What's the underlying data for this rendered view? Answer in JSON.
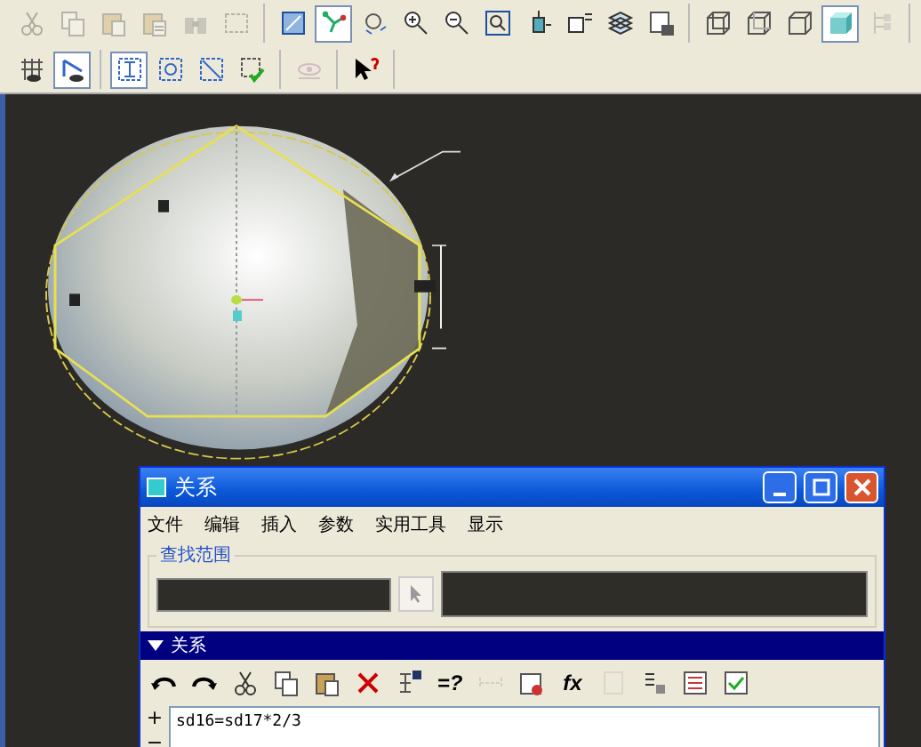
{
  "toolbar_rows": [
    {
      "groups": [
        [
          {
            "kind": "cut",
            "pressed": false,
            "disabled": true
          },
          {
            "kind": "copy",
            "pressed": false,
            "disabled": true
          },
          {
            "kind": "paste",
            "pressed": false,
            "disabled": true
          },
          {
            "kind": "paste-special",
            "pressed": false,
            "disabled": true
          },
          {
            "kind": "find",
            "pressed": false,
            "disabled": true
          },
          {
            "kind": "select-box",
            "pressed": false,
            "disabled": true
          }
        ],
        [
          {
            "kind": "sketch",
            "pressed": false,
            "disabled": false
          },
          {
            "kind": "datum",
            "pressed": true,
            "disabled": false
          },
          {
            "kind": "spin",
            "pressed": false,
            "disabled": false
          },
          {
            "kind": "zoom-in",
            "pressed": false,
            "disabled": false
          },
          {
            "kind": "zoom-out",
            "pressed": false,
            "disabled": false
          },
          {
            "kind": "refit",
            "pressed": false,
            "disabled": false
          },
          {
            "kind": "orient",
            "pressed": false,
            "disabled": false
          },
          {
            "kind": "view",
            "pressed": false,
            "disabled": false
          },
          {
            "kind": "layers",
            "pressed": false,
            "disabled": false
          },
          {
            "kind": "setup",
            "pressed": false,
            "disabled": false
          }
        ],
        [
          {
            "kind": "wireframe",
            "pressed": false,
            "disabled": false
          },
          {
            "kind": "hidden",
            "pressed": false,
            "disabled": false
          },
          {
            "kind": "no-hidden",
            "pressed": false,
            "disabled": false
          },
          {
            "kind": "shaded",
            "pressed": true,
            "disabled": false
          },
          {
            "kind": "tree",
            "pressed": false,
            "disabled": true
          }
        ]
      ]
    },
    {
      "groups": [
        [
          {
            "kind": "grid",
            "pressed": false,
            "disabled": false
          },
          {
            "kind": "sketch-view",
            "pressed": true,
            "disabled": false
          }
        ],
        [
          {
            "kind": "constrain",
            "pressed": true,
            "disabled": false
          },
          {
            "kind": "constrain-b",
            "pressed": false,
            "disabled": false
          },
          {
            "kind": "constrain-c",
            "pressed": false,
            "disabled": false
          },
          {
            "kind": "check",
            "pressed": false,
            "disabled": false
          }
        ],
        [
          {
            "kind": "sketcher-check",
            "pressed": false,
            "disabled": true
          }
        ],
        [
          {
            "kind": "help",
            "pressed": false,
            "disabled": false
          }
        ]
      ]
    }
  ],
  "dialog": {
    "title": "关系",
    "menu": [
      "文件",
      "编辑",
      "插入",
      "参数",
      "实用工具",
      "显示"
    ],
    "look_in": {
      "label": "查找范围"
    },
    "section": {
      "label": "关系",
      "expanded": true
    },
    "tools": [
      {
        "kind": "undo",
        "disabled": false
      },
      {
        "kind": "redo",
        "disabled": false
      },
      {
        "kind": "cut",
        "disabled": false
      },
      {
        "kind": "copy",
        "disabled": false
      },
      {
        "kind": "paste",
        "disabled": false
      },
      {
        "kind": "delete",
        "disabled": false
      },
      {
        "kind": "dims",
        "disabled": false
      },
      {
        "kind": "text",
        "label": "=?",
        "disabled": false
      },
      {
        "kind": "range",
        "disabled": true
      },
      {
        "kind": "units",
        "disabled": false
      },
      {
        "kind": "text",
        "label": "fx",
        "disabled": false
      },
      {
        "kind": "blank",
        "disabled": true
      },
      {
        "kind": "sort",
        "disabled": false
      },
      {
        "kind": "list",
        "disabled": false
      },
      {
        "kind": "verify",
        "disabled": false
      }
    ],
    "gutter_marks": [
      "+",
      "−"
    ],
    "editor": {
      "lines": [
        "sd16=sd17*2/3"
      ]
    }
  }
}
